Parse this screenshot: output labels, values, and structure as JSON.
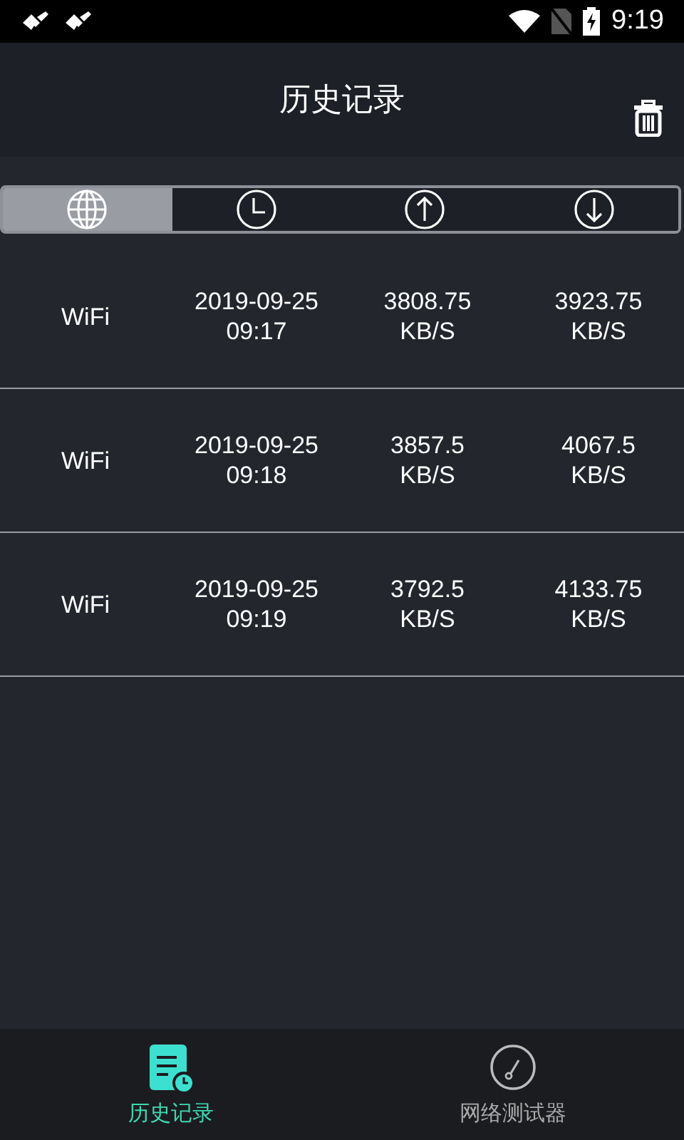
{
  "status_bar": {
    "time": "9:19"
  },
  "header": {
    "title": "历史记录"
  },
  "tabs": [
    {
      "kind": "network",
      "selected": true
    },
    {
      "kind": "time",
      "selected": false
    },
    {
      "kind": "upload",
      "selected": false
    },
    {
      "kind": "download",
      "selected": false
    }
  ],
  "rows": [
    {
      "cells": [
        [
          "WiFi"
        ],
        [
          "2019-09-25",
          "09:17"
        ],
        [
          "3808.75",
          "KB/S"
        ],
        [
          "3923.75",
          "KB/S"
        ]
      ]
    },
    {
      "cells": [
        [
          "WiFi"
        ],
        [
          "2019-09-25",
          "09:18"
        ],
        [
          "3857.5",
          "KB/S"
        ],
        [
          "4067.5",
          "KB/S"
        ]
      ]
    },
    {
      "cells": [
        [
          "WiFi"
        ],
        [
          "2019-09-25",
          "09:19"
        ],
        [
          "3792.5",
          "KB/S"
        ],
        [
          "4133.75",
          "KB/S"
        ]
      ]
    }
  ],
  "bottom_nav": [
    {
      "kind": "history",
      "label": "历史记录",
      "selected": true
    },
    {
      "kind": "speedtest",
      "label": "网络测试器",
      "selected": false
    }
  ]
}
